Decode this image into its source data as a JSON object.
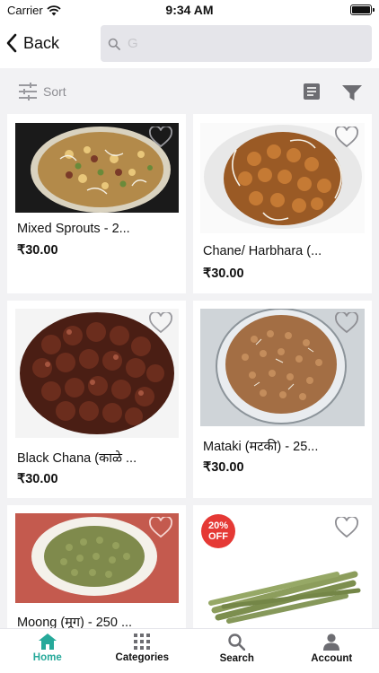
{
  "status_bar": {
    "carrier": "Carrier",
    "time": "9:34 AM"
  },
  "header": {
    "back_label": "Back",
    "search": {
      "value": "",
      "placeholder": "G"
    }
  },
  "toolbar": {
    "sort_label": "Sort"
  },
  "products": [
    {
      "name": "Mixed Sprouts - 2...",
      "price": "₹30.00"
    },
    {
      "name": "Chane/ Harbhara (...",
      "price": "₹30.00"
    },
    {
      "name": "Black Chana (काळे ...",
      "price": "₹30.00"
    },
    {
      "name": "Mataki (मटकी) - 25...",
      "price": "₹30.00"
    },
    {
      "name": "Moong (मूग) - 250 ...",
      "price": ""
    },
    {
      "name": "",
      "price": "",
      "badge": {
        "line1": "20%",
        "line2": "OFF"
      }
    }
  ],
  "tabs": [
    {
      "label": "Home",
      "icon": "home-icon",
      "active": true
    },
    {
      "label": "Categories",
      "icon": "grid-icon",
      "active": false
    },
    {
      "label": "Search",
      "icon": "search-icon",
      "active": false
    },
    {
      "label": "Account",
      "icon": "person-icon",
      "active": false
    }
  ],
  "colors": {
    "accent": "#26a99a",
    "badge": "#e53935",
    "background": "#f2f2f4"
  }
}
